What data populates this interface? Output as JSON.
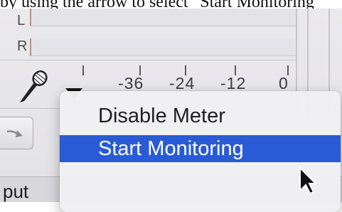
{
  "caption": "by using the arrow to select “Start Monitoring”",
  "meters": {
    "left_label": "L",
    "right_label": "R"
  },
  "scale": {
    "labels": [
      "-36",
      "-24",
      "-12",
      "0"
    ]
  },
  "menu": {
    "items": [
      {
        "label": "Disable Meter",
        "selected": false
      },
      {
        "label": "Start Monitoring",
        "selected": true
      },
      {
        "label": "",
        "selected": false
      }
    ]
  },
  "bottom": {
    "text": "put"
  },
  "icons": {
    "microphone": "microphone-icon",
    "dropdown": "dropdown-arrow-icon",
    "toolbar": "redo-icon",
    "cursor": "mouse-pointer-icon"
  },
  "colors": {
    "highlight": "#2a5bd6",
    "peak_line": "#c98a8a"
  }
}
